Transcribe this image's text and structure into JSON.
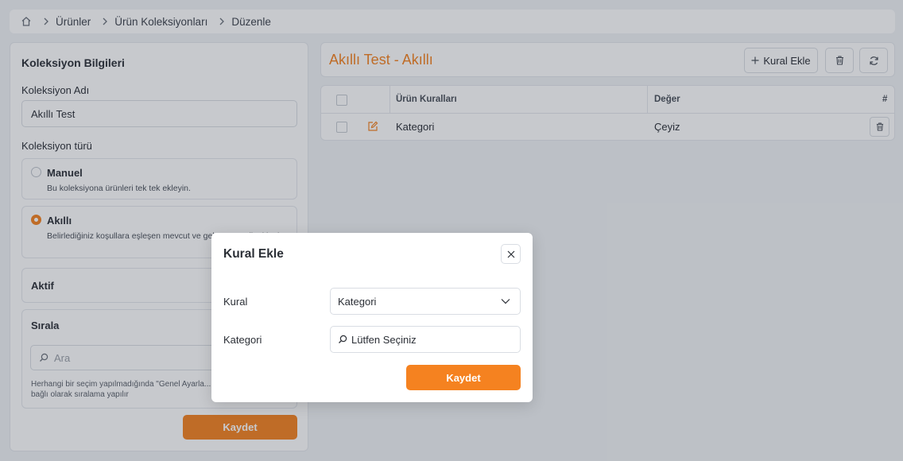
{
  "breadcrumb": {
    "items": [
      "Ürünler",
      "Ürün Koleksiyonları",
      "Düzenle"
    ]
  },
  "left_panel": {
    "title": "Koleksiyon Bilgileri",
    "name_label": "Koleksiyon Adı",
    "name_value": "Akıllı Test",
    "type_label": "Koleksiyon türü",
    "type_options": [
      {
        "title": "Manuel",
        "desc": "Bu koleksiyona ürünleri tek tek ekleyin.",
        "selected": false
      },
      {
        "title": "Akıllı",
        "desc": "Belirlediğiniz koşullara eşleşen mevcut ve gel... otomatik eklenir.",
        "selected": true
      }
    ],
    "active_label": "Aktif",
    "sort_label": "Sırala",
    "sort_placeholder": "Ara",
    "sort_note": "Herhangi bir seçim yapılmadığında \"Genel Ayarla... Tercihi\" ayarına bağlı olarak sıralama yapılır",
    "save_label": "Kaydet"
  },
  "header": {
    "title": "Akıllı Test - Akıllı",
    "add_rule_label": "Kural Ekle"
  },
  "table": {
    "columns": [
      "Ürün Kuralları",
      "Değer",
      "#"
    ],
    "rows": [
      {
        "rule": "Kategori",
        "value": "Çeyiz"
      }
    ]
  },
  "modal": {
    "title": "Kural Ekle",
    "rule_label": "Kural",
    "rule_value": "Kategori",
    "category_label": "Kategori",
    "category_placeholder": "Lütfen Seçiniz",
    "save_label": "Kaydet"
  },
  "colors": {
    "accent": "#f58220",
    "background": "#f1f3f6"
  }
}
